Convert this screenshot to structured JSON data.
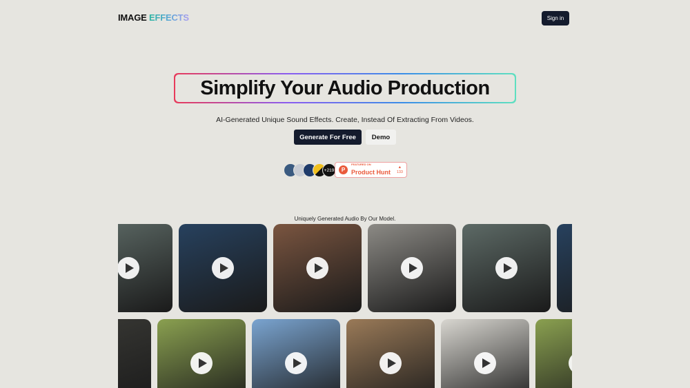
{
  "header": {
    "logo_part1": "IMAGE",
    "logo_part2": "EFFECTS",
    "signin_label": "Sign in"
  },
  "hero": {
    "title": "Simplify Your Audio Production",
    "subtitle": "AI-Generated Unique Sound Effects. Create, Instead Of Extracting From Videos.",
    "primary_button": "Generate For Free",
    "secondary_button": "Demo"
  },
  "social": {
    "avatar_count": "+219",
    "product_hunt": {
      "featured": "FEATURED ON",
      "name": "Product Hunt",
      "votes": "133"
    }
  },
  "gallery": {
    "caption": "Uniquely Generated Audio By Our Model.",
    "row1": [
      {
        "scene": "car-on-road",
        "color": "#5d6a66"
      },
      {
        "scene": "house-at-night",
        "color": "#27415e"
      },
      {
        "scene": "fireplace-cabin",
        "color": "#7a5540"
      },
      {
        "scene": "mma-fight",
        "color": "#8c8a85"
      },
      {
        "scene": "car-on-road",
        "color": "#5d6a66"
      },
      {
        "scene": "house-at-night",
        "color": "#27415e"
      }
    ],
    "row2": [
      {
        "scene": "wall-clock",
        "color": "#3a3a36"
      },
      {
        "scene": "kitten-in-grass",
        "color": "#8aa050"
      },
      {
        "scene": "horse-rider",
        "color": "#7aa4d0"
      },
      {
        "scene": "restaurant-robot",
        "color": "#9a7a58"
      },
      {
        "scene": "wall-clock",
        "color": "#d8d6d0"
      },
      {
        "scene": "kitten-in-grass",
        "color": "#8aa050"
      }
    ]
  }
}
